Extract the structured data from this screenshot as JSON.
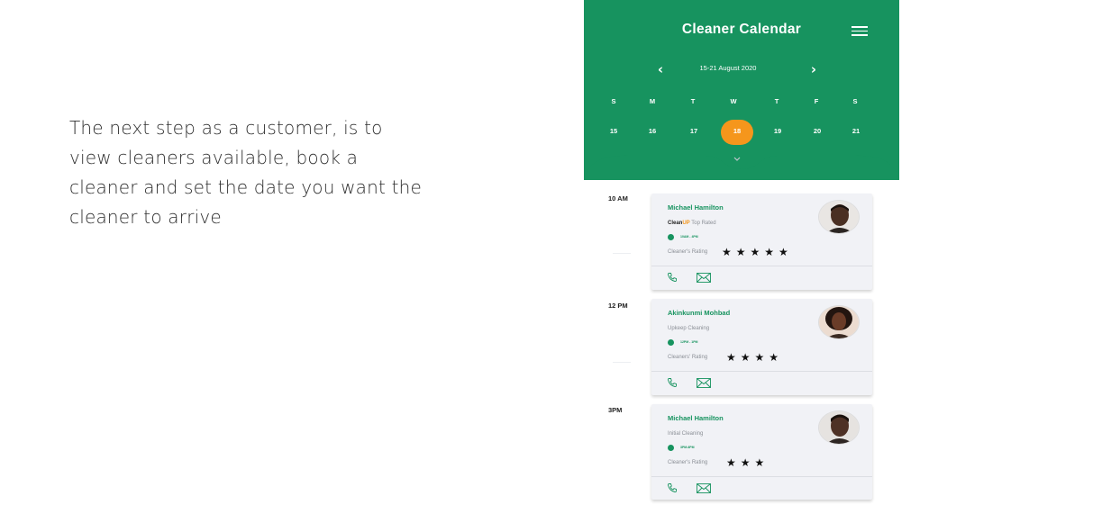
{
  "description": "The next step as a customer, is to view cleaners available, book a cleaner and set the date you want the cleaner to arrive",
  "app": {
    "title": "Cleaner Calendar",
    "menu_icon": "menu-icon",
    "week_range": "15-21 August 2020",
    "prev_icon": "chevron-left-icon",
    "next_icon": "chevron-right-icon",
    "days": [
      {
        "dow": "S",
        "date": "15"
      },
      {
        "dow": "M",
        "date": "16"
      },
      {
        "dow": "T",
        "date": "17"
      },
      {
        "dow": "W",
        "date": "18"
      },
      {
        "dow": "T",
        "date": "19"
      },
      {
        "dow": "F",
        "date": "20"
      },
      {
        "dow": "S",
        "date": "21"
      }
    ],
    "selected_date": "18",
    "colors": {
      "primary": "#17935f",
      "accent": "#f5961c",
      "card": "#f1f2f6"
    }
  },
  "schedule": [
    {
      "time": "10 AM",
      "name": "Michael Hamilton",
      "tag_prefix": "Clean",
      "tag_brand": "UP",
      "tag_rest": " Top Rated",
      "hours": "10AM - 4PM",
      "rating_label": "Cleaner's Rating",
      "rating": 5,
      "stars": "★★★★★"
    },
    {
      "time": "12 PM",
      "name": "Akinkunmi Mohbad",
      "tag_prefix": "",
      "tag_brand": "",
      "tag_rest": "Upkeep Cleaning",
      "hours": "12PM - 1PM",
      "rating_label": "Cleaners' Rating",
      "rating": 4,
      "stars": "★★★★"
    },
    {
      "time": "3PM",
      "name": "Michael Hamilton",
      "tag_prefix": "",
      "tag_brand": "",
      "tag_rest": "Initial Cleaning",
      "hours": "3PM-6PM",
      "rating_label": "Cleaner's Rating",
      "rating": 3,
      "stars": "★★★"
    }
  ]
}
